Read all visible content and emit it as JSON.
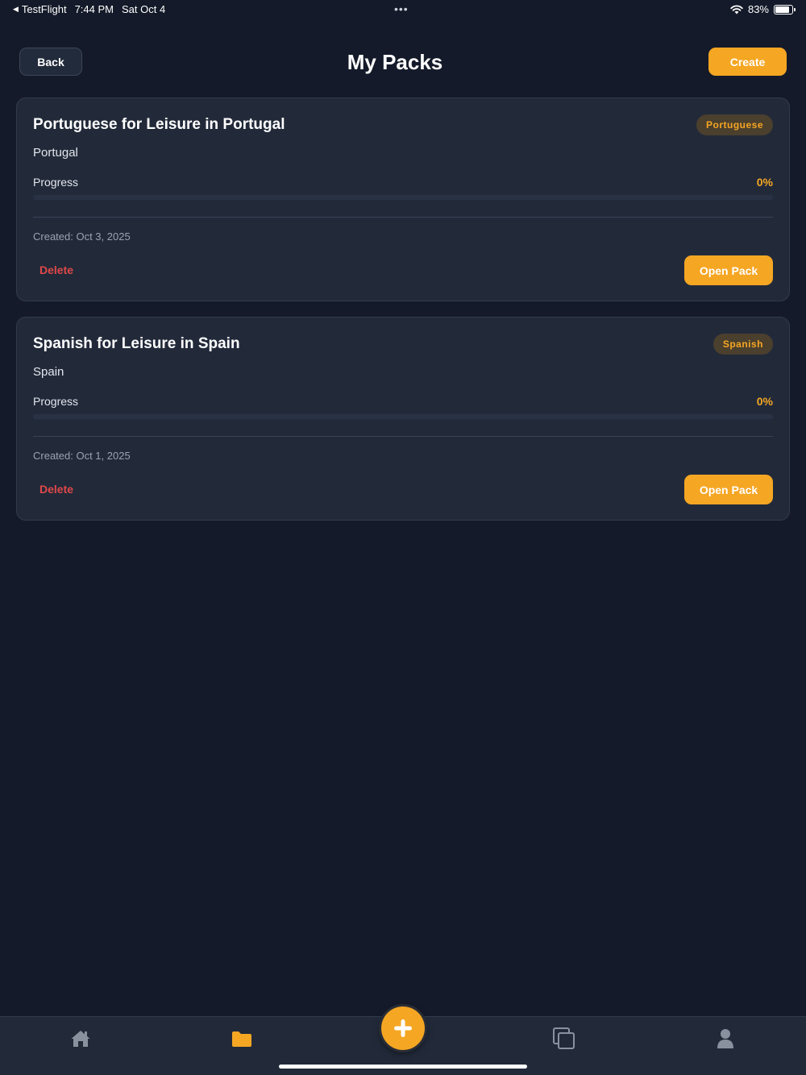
{
  "status_bar": {
    "app": "TestFlight",
    "time": "7:44 PM",
    "date": "Sat Oct 4",
    "dots": "•••",
    "battery": "83%",
    "battery_level": 0.83
  },
  "header": {
    "back_label": "Back",
    "title": "My Packs",
    "create_label": "Create"
  },
  "packs": [
    {
      "title": "Portuguese for Leisure in Portugal",
      "badge": "Portuguese",
      "location": "Portugal",
      "progress_label": "Progress",
      "progress_text": "0%",
      "progress": 0,
      "created": "Created: Oct 3, 2025",
      "delete_label": "Delete",
      "open_label": "Open Pack"
    },
    {
      "title": "Spanish for Leisure in Spain",
      "badge": "Spanish",
      "location": "Spain",
      "progress_label": "Progress",
      "progress_text": "0%",
      "progress": 0,
      "created": "Created: Oct 1, 2025",
      "delete_label": "Delete",
      "open_label": "Open Pack"
    }
  ],
  "tab_bar": {
    "tabs": [
      {
        "icon": "home-icon",
        "active": false
      },
      {
        "icon": "folder-icon",
        "active": true
      },
      {
        "icon": "add-icon",
        "active": false
      },
      {
        "icon": "copy-icon",
        "active": false
      },
      {
        "icon": "profile-icon",
        "active": false
      }
    ]
  },
  "colors": {
    "accent": "#f5a623",
    "background": "#141a29",
    "card": "#222a3a",
    "danger": "#e04848",
    "badge_bg": "#4b3f2d"
  }
}
